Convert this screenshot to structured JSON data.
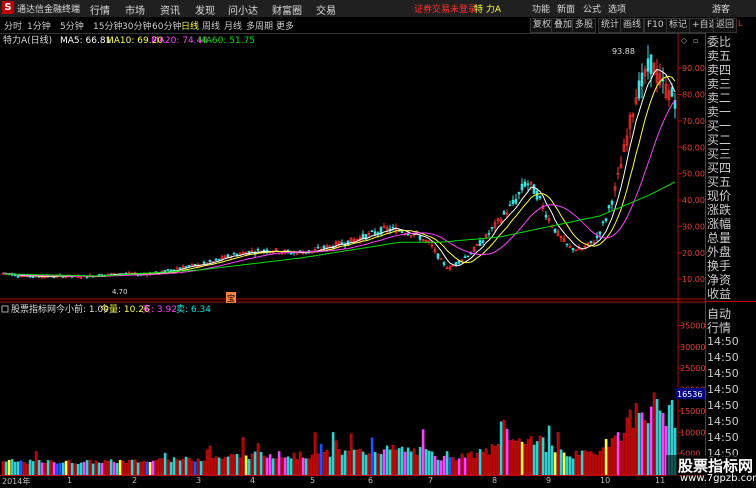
{
  "menubar": {
    "logo_text": "S",
    "app_title": "通达信金融终端",
    "menus": [
      "行情",
      "市场",
      "资讯",
      "发现",
      "问小达",
      "财富圈",
      "交易"
    ],
    "notice": "证券交易未登录",
    "stock_name": "特 力A",
    "right_menus": [
      "功能",
      "新面",
      "公式",
      "选项"
    ],
    "user": "游客"
  },
  "toolbar": {
    "periods": [
      "分时",
      "1分钟",
      "5分钟",
      "15分钟",
      "30分钟",
      "60分钟",
      "日线",
      "周线",
      "月线",
      "多周期",
      "更多"
    ],
    "active_period": "日线",
    "tools": [
      "复权",
      "叠加",
      "多股",
      "统计",
      "画线",
      "F10",
      "标记",
      "+自选",
      "返回"
    ]
  },
  "main_chart": {
    "title": "特力A(日线)",
    "ma_labels": [
      {
        "text": "MA5: 66.81",
        "color": "#ffffff"
      },
      {
        "text": "MA10: 69.20",
        "color": "#ffff40"
      },
      {
        "text": "MA20: 74.44",
        "color": "#ff40ff"
      },
      {
        "text": "MA60: 51.75",
        "color": "#00e000"
      }
    ],
    "high_label": "93.88",
    "low_label": "4.70",
    "event_marker": "宝",
    "y_ticks": [
      "90.00",
      "80.00",
      "70.00",
      "60.00",
      "50.00",
      "40.00",
      "30.00",
      "20.00",
      "10.00"
    ]
  },
  "volume_chart": {
    "title": "股票指标网",
    "params": [
      {
        "text": "今小前: 1.00",
        "color": "#dddddd"
      },
      {
        "text": "今量: 10.26",
        "color": "#ffff40"
      },
      {
        "text": "买: 3.92",
        "color": "#ff40ff"
      },
      {
        "text": "卖: 6.34",
        "color": "#00e0e0"
      }
    ],
    "y_ticks": [
      "35000",
      "30000",
      "25000",
      "20000",
      "15000",
      "10000",
      "5000"
    ],
    "current_value": "16536"
  },
  "x_axis": {
    "labels": [
      "2014年",
      "1",
      "2",
      "3",
      "4",
      "5",
      "6",
      "7",
      "8",
      "9",
      "10",
      "11"
    ]
  },
  "right_panel": {
    "items": [
      "委比",
      "卖五",
      "卖四",
      "卖三",
      "卖二",
      "卖一",
      "买一",
      "买二",
      "买三",
      "买四",
      "买五",
      "现价",
      "涨跌",
      "涨幅",
      "总量",
      "外盘",
      "换手",
      "净资",
      "收益"
    ],
    "sub_tab": "自动",
    "sub_label": "行情",
    "times": [
      "14:50",
      "14:50",
      "14:50",
      "14:50",
      "14:50",
      "14:50",
      "14:50",
      "14:50"
    ]
  },
  "watermark": {
    "title": "股票指标网",
    "url": "www.7gpzb.com"
  },
  "colors": {
    "up": "#ff3030",
    "down": "#40e0e0",
    "axis": "#c00000",
    "ma5": "#ffffff",
    "ma10": "#ffff40",
    "ma20": "#ff40ff",
    "ma60": "#00e000"
  },
  "chart_data": {
    "type": "candlestick",
    "price_approx": [
      [
        1,
        12.2
      ],
      [
        10,
        12.0
      ],
      [
        20,
        11.3
      ],
      [
        40,
        11.0
      ],
      [
        60,
        11.2
      ],
      [
        80,
        11.0
      ],
      [
        100,
        11.5
      ],
      [
        120,
        12.0
      ],
      [
        140,
        11.8
      ],
      [
        160,
        12.5
      ],
      [
        180,
        14.5
      ],
      [
        200,
        15.5
      ],
      [
        215,
        17.0
      ],
      [
        230,
        19.0
      ],
      [
        250,
        20.5
      ],
      [
        270,
        21.0
      ],
      [
        290,
        20.0
      ],
      [
        310,
        20.5
      ],
      [
        330,
        22.5
      ],
      [
        350,
        24.5
      ],
      [
        370,
        27.0
      ],
      [
        385,
        29.0
      ],
      [
        400,
        28.5
      ],
      [
        415,
        27.0
      ],
      [
        430,
        23.0
      ],
      [
        440,
        17.0
      ],
      [
        448,
        14.0
      ],
      [
        455,
        16.0
      ],
      [
        470,
        20.0
      ],
      [
        485,
        26.0
      ],
      [
        500,
        33.0
      ],
      [
        515,
        40.0
      ],
      [
        525,
        47.0
      ],
      [
        535,
        43.0
      ],
      [
        545,
        35.0
      ],
      [
        555,
        28.0
      ],
      [
        568,
        22.0
      ],
      [
        580,
        21.0
      ],
      [
        595,
        25.0
      ],
      [
        605,
        33.0
      ],
      [
        615,
        45.0
      ],
      [
        625,
        62.0
      ],
      [
        635,
        80.0
      ],
      [
        642,
        85.0
      ],
      [
        650,
        92.0
      ],
      [
        660,
        84.0
      ],
      [
        670,
        80.0
      ],
      [
        680,
        76.0
      ],
      [
        690,
        72.0
      ],
      [
        700,
        65.0
      ]
    ],
    "ma60_approx": [
      [
        1,
        12.0
      ],
      [
        100,
        11.2
      ],
      [
        200,
        13.5
      ],
      [
        300,
        18.0
      ],
      [
        400,
        24.0
      ],
      [
        440,
        24.0
      ],
      [
        500,
        26.0
      ],
      [
        550,
        30.0
      ],
      [
        600,
        34.0
      ],
      [
        650,
        42.0
      ],
      [
        700,
        51.75
      ]
    ],
    "ylim": [
      4,
      98
    ],
    "volume_ylim": [
      0,
      37000
    ]
  }
}
